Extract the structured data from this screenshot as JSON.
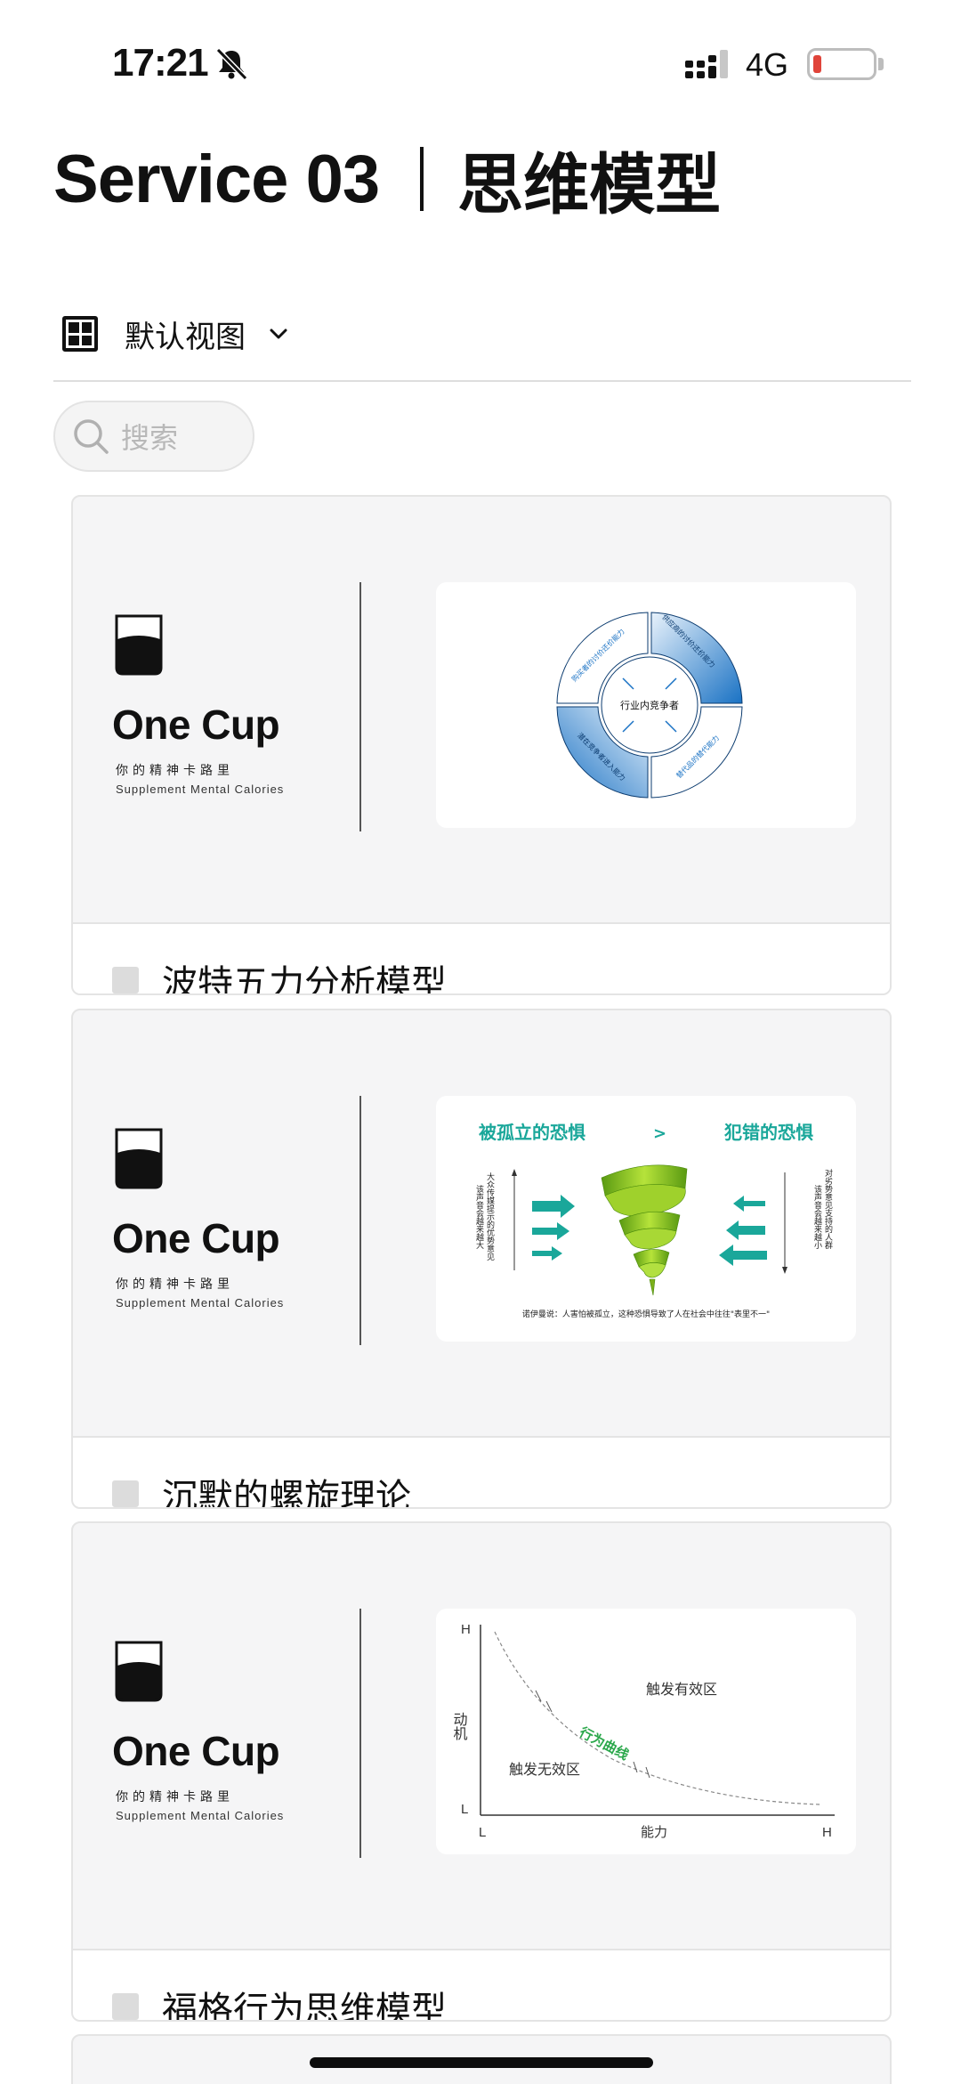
{
  "status": {
    "time": "17:21",
    "network": "4G"
  },
  "header": {
    "title_en": "Service 03",
    "title_cn": "思维模型"
  },
  "view": {
    "label": "默认视图"
  },
  "search": {
    "placeholder": "搜索"
  },
  "brand": {
    "name": "One Cup",
    "tagline_cn": "你的精神卡路里",
    "tagline_en": "Supplement Mental Calories"
  },
  "cards": [
    {
      "title": "波特五力分析模型",
      "diagram": {
        "center": "行业内竞争者",
        "segments": [
          "供应商的讨价还价能力",
          "替代品的替代能力",
          "潜在竞争者进入能力",
          "购买者的讨价还价能力"
        ]
      }
    },
    {
      "title": "沉默的螺旋理论",
      "diagram": {
        "left_heading": "被孤立的恐惧",
        "operator": ">",
        "right_heading": "犯错的恐惧",
        "left_side": "大众传媒提示的优势意见 该声音会越来越大",
        "right_side": "对劣势意见支持的人群 该声音会越来越小",
        "caption": "诺伊曼说：人害怕被孤立，这种恐惧导致了人在社会中往往\"表里不一\""
      }
    },
    {
      "title": "福格行为思维模型",
      "diagram": {
        "y_label": "动机",
        "x_label": "能力",
        "y_high": "H",
        "y_low": "L",
        "x_low": "L",
        "x_high": "H",
        "zone_high": "触发有效区",
        "zone_low": "触发无效区",
        "curve_label": "行为曲线"
      }
    }
  ],
  "colors": {
    "accent_blue": "#1a72c4",
    "accent_teal": "#1aa79a",
    "accent_green": "#8cc21f"
  }
}
